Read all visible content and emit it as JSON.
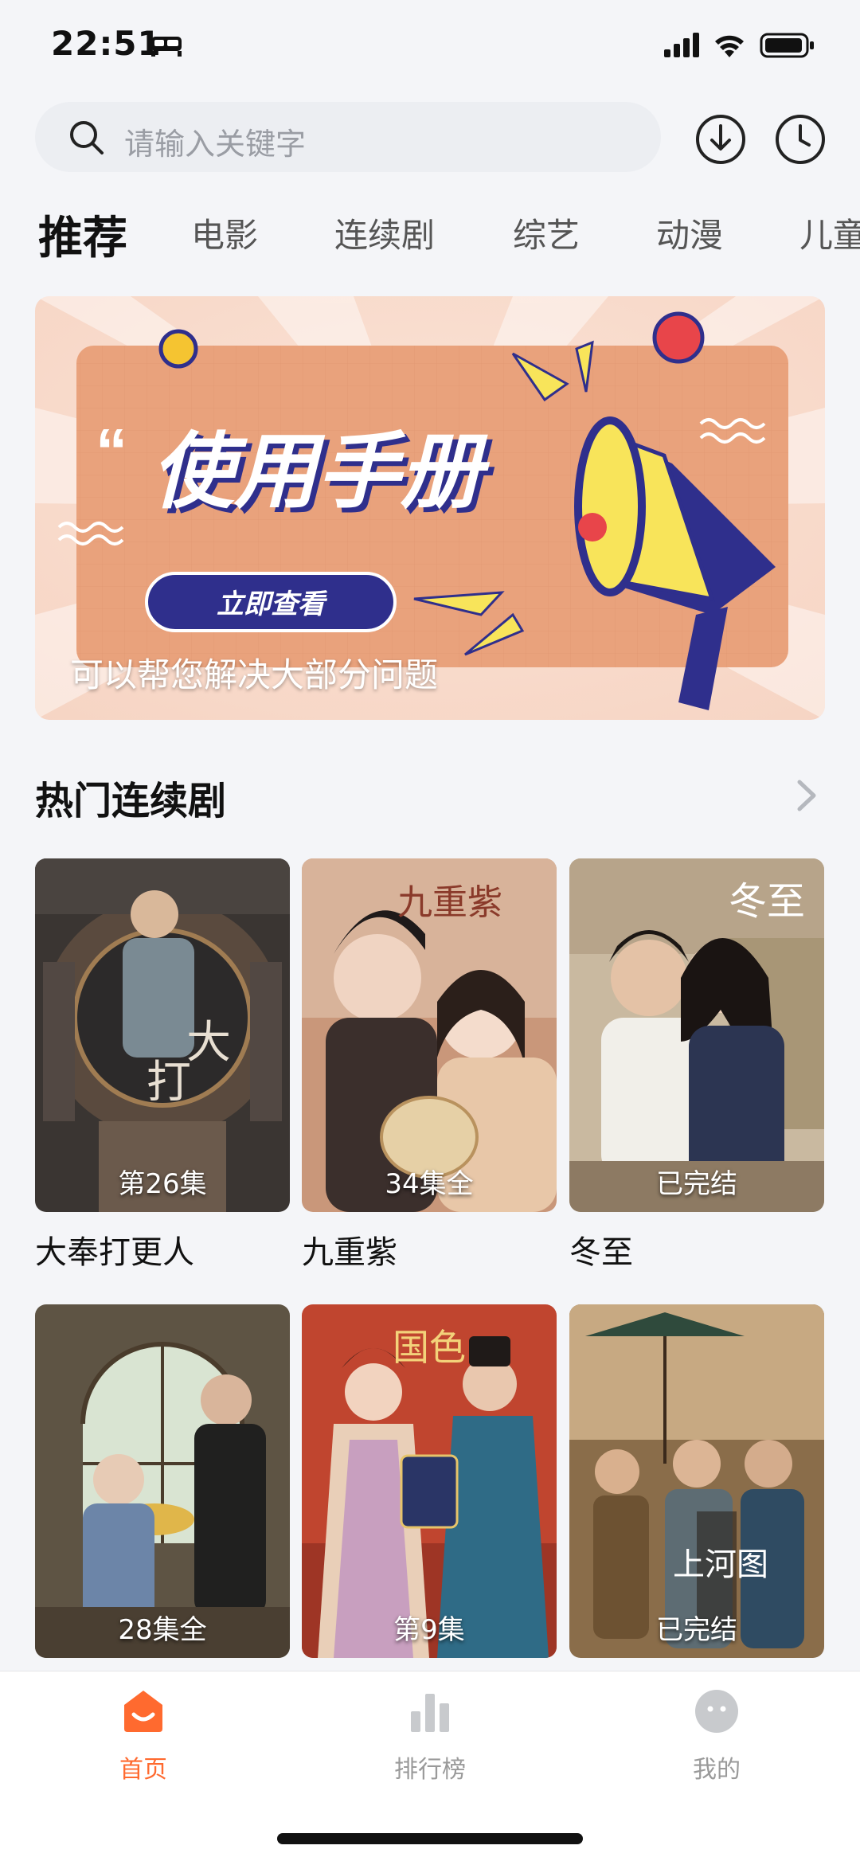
{
  "status_bar": {
    "time": "22:51",
    "icons": [
      "bed-icon",
      "signal-icon",
      "wifi-icon",
      "battery-icon"
    ]
  },
  "search": {
    "placeholder": "请输入关键字",
    "icons": [
      "search-icon",
      "download-icon",
      "history-icon"
    ]
  },
  "tabs": [
    "推荐",
    "电影",
    "连续剧",
    "综艺",
    "动漫",
    "儿童"
  ],
  "active_tab": "推荐",
  "banner": {
    "headline": "使用手册",
    "button_label": "立即查看",
    "caption": "可以帮您解决大部分问题"
  },
  "section": {
    "title": "热门连续剧"
  },
  "cards": [
    {
      "title": "大奉打更人",
      "badge": "第26集"
    },
    {
      "title": "九重紫",
      "badge": "34集全"
    },
    {
      "title": "冬至",
      "badge": "已完结"
    },
    {
      "title": "",
      "badge": "28集全"
    },
    {
      "title": "",
      "badge": "第9集"
    },
    {
      "title": "",
      "badge": "已完结"
    }
  ],
  "bottom_nav": [
    {
      "label": "首页",
      "icon": "home-icon",
      "active": true
    },
    {
      "label": "排行榜",
      "icon": "ranking-icon",
      "active": false
    },
    {
      "label": "我的",
      "icon": "profile-icon",
      "active": false
    }
  ],
  "colors": {
    "accent": "#ff6a2f",
    "banner_bg": "#e9a27c",
    "banner_button": "#2f2f8c"
  }
}
